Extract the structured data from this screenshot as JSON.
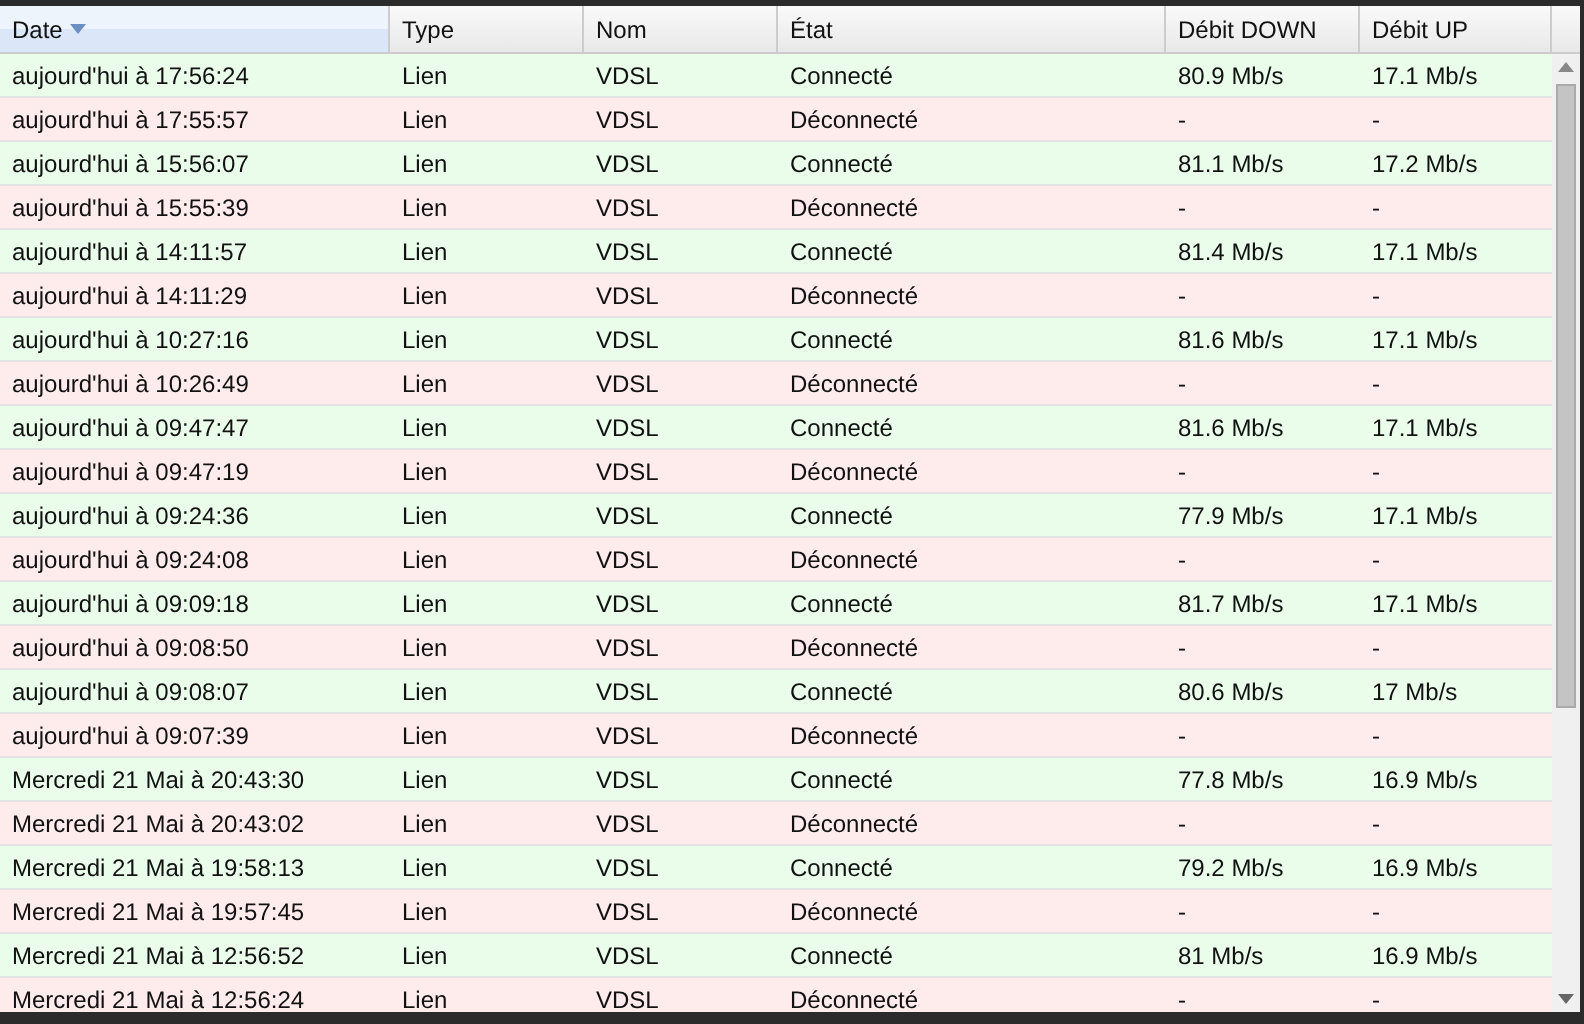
{
  "table": {
    "columns": [
      {
        "label": "Date",
        "sorted": true
      },
      {
        "label": "Type",
        "sorted": false
      },
      {
        "label": "Nom",
        "sorted": false
      },
      {
        "label": "État",
        "sorted": false
      },
      {
        "label": "Débit DOWN",
        "sorted": false
      },
      {
        "label": "Débit UP",
        "sorted": false
      }
    ],
    "rows": [
      {
        "kind": "connected",
        "cells": [
          "aujourd'hui à 17:56:24",
          "Lien",
          "VDSL",
          "Connecté",
          "80.9 Mb/s",
          "17.1 Mb/s"
        ]
      },
      {
        "kind": "disconnected",
        "cells": [
          "aujourd'hui à 17:55:57",
          "Lien",
          "VDSL",
          "Déconnecté",
          "-",
          "-"
        ]
      },
      {
        "kind": "connected",
        "cells": [
          "aujourd'hui à 15:56:07",
          "Lien",
          "VDSL",
          "Connecté",
          "81.1 Mb/s",
          "17.2 Mb/s"
        ]
      },
      {
        "kind": "disconnected",
        "cells": [
          "aujourd'hui à 15:55:39",
          "Lien",
          "VDSL",
          "Déconnecté",
          "-",
          "-"
        ]
      },
      {
        "kind": "connected",
        "cells": [
          "aujourd'hui à 14:11:57",
          "Lien",
          "VDSL",
          "Connecté",
          "81.4 Mb/s",
          "17.1 Mb/s"
        ]
      },
      {
        "kind": "disconnected",
        "cells": [
          "aujourd'hui à 14:11:29",
          "Lien",
          "VDSL",
          "Déconnecté",
          "-",
          "-"
        ]
      },
      {
        "kind": "connected",
        "cells": [
          "aujourd'hui à 10:27:16",
          "Lien",
          "VDSL",
          "Connecté",
          "81.6 Mb/s",
          "17.1 Mb/s"
        ]
      },
      {
        "kind": "disconnected",
        "cells": [
          "aujourd'hui à 10:26:49",
          "Lien",
          "VDSL",
          "Déconnecté",
          "-",
          "-"
        ]
      },
      {
        "kind": "connected",
        "cells": [
          "aujourd'hui à 09:47:47",
          "Lien",
          "VDSL",
          "Connecté",
          "81.6 Mb/s",
          "17.1 Mb/s"
        ]
      },
      {
        "kind": "disconnected",
        "cells": [
          "aujourd'hui à 09:47:19",
          "Lien",
          "VDSL",
          "Déconnecté",
          "-",
          "-"
        ]
      },
      {
        "kind": "connected",
        "cells": [
          "aujourd'hui à 09:24:36",
          "Lien",
          "VDSL",
          "Connecté",
          "77.9 Mb/s",
          "17.1 Mb/s"
        ]
      },
      {
        "kind": "disconnected",
        "cells": [
          "aujourd'hui à 09:24:08",
          "Lien",
          "VDSL",
          "Déconnecté",
          "-",
          "-"
        ]
      },
      {
        "kind": "connected",
        "cells": [
          "aujourd'hui à 09:09:18",
          "Lien",
          "VDSL",
          "Connecté",
          "81.7 Mb/s",
          "17.1 Mb/s"
        ]
      },
      {
        "kind": "disconnected",
        "cells": [
          "aujourd'hui à 09:08:50",
          "Lien",
          "VDSL",
          "Déconnecté",
          "-",
          "-"
        ]
      },
      {
        "kind": "connected",
        "cells": [
          "aujourd'hui à 09:08:07",
          "Lien",
          "VDSL",
          "Connecté",
          "80.6 Mb/s",
          "17 Mb/s"
        ]
      },
      {
        "kind": "disconnected",
        "cells": [
          "aujourd'hui à 09:07:39",
          "Lien",
          "VDSL",
          "Déconnecté",
          "-",
          "-"
        ]
      },
      {
        "kind": "connected",
        "cells": [
          "Mercredi 21 Mai à 20:43:30",
          "Lien",
          "VDSL",
          "Connecté",
          "77.8 Mb/s",
          "16.9 Mb/s"
        ]
      },
      {
        "kind": "disconnected",
        "cells": [
          "Mercredi 21 Mai à 20:43:02",
          "Lien",
          "VDSL",
          "Déconnecté",
          "-",
          "-"
        ]
      },
      {
        "kind": "connected",
        "cells": [
          "Mercredi 21 Mai à 19:58:13",
          "Lien",
          "VDSL",
          "Connecté",
          "79.2 Mb/s",
          "16.9 Mb/s"
        ]
      },
      {
        "kind": "disconnected",
        "cells": [
          "Mercredi 21 Mai à 19:57:45",
          "Lien",
          "VDSL",
          "Déconnecté",
          "-",
          "-"
        ]
      },
      {
        "kind": "connected",
        "cells": [
          "Mercredi 21 Mai à 12:56:52",
          "Lien",
          "VDSL",
          "Connecté",
          "81 Mb/s",
          "16.9 Mb/s"
        ]
      },
      {
        "kind": "disconnected",
        "cells": [
          "Mercredi 21 Mai à 12:56:24",
          "Lien",
          "VDSL",
          "Déconnecté",
          "-",
          "-"
        ]
      }
    ]
  }
}
